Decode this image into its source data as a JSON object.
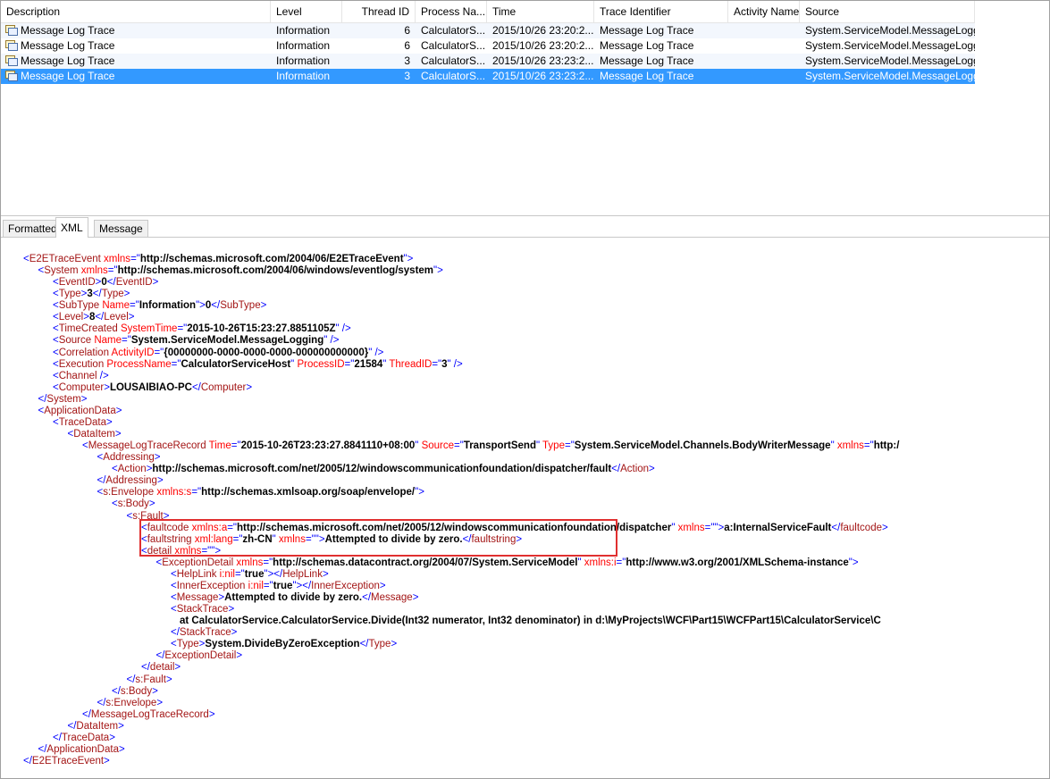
{
  "columns": [
    "Description",
    "Level",
    "Thread ID",
    "Process Na...",
    "Time",
    "Trace Identifier",
    "Activity Name",
    "Source"
  ],
  "rows": [
    {
      "description": "Message Log Trace",
      "level": "Information",
      "thread": "6",
      "process": "CalculatorS...",
      "time": "2015/10/26 23:20:2...",
      "trace": "Message Log Trace",
      "activity": "",
      "source": "System.ServiceModel.MessageLogging"
    },
    {
      "description": "Message Log Trace",
      "level": "Information",
      "thread": "6",
      "process": "CalculatorS...",
      "time": "2015/10/26 23:20:2...",
      "trace": "Message Log Trace",
      "activity": "",
      "source": "System.ServiceModel.MessageLogging"
    },
    {
      "description": "Message Log Trace",
      "level": "Information",
      "thread": "3",
      "process": "CalculatorS...",
      "time": "2015/10/26 23:23:2...",
      "trace": "Message Log Trace",
      "activity": "",
      "source": "System.ServiceModel.MessageLogging"
    },
    {
      "description": "Message Log Trace",
      "level": "Information",
      "thread": "3",
      "process": "CalculatorS...",
      "time": "2015/10/26 23:23:2...",
      "trace": "Message Log Trace",
      "activity": "",
      "source": "System.ServiceModel.MessageLogging"
    }
  ],
  "selected_row": 3,
  "tabs": [
    "Formatted",
    "XML",
    "Message"
  ],
  "active_tab": "XML",
  "xml_lines": [
    {
      "indent": 0,
      "parts": [
        [
          "b",
          "<"
        ],
        [
          "t",
          "E2ETraceEvent "
        ],
        [
          "r",
          "xmlns"
        ],
        [
          "b",
          "=\""
        ],
        [
          "k",
          "http://schemas.microsoft.com/2004/06/E2ETraceEvent"
        ],
        [
          "b",
          "\">"
        ]
      ]
    },
    {
      "indent": 1,
      "parts": [
        [
          "b",
          "<"
        ],
        [
          "t",
          "System "
        ],
        [
          "r",
          "xmlns"
        ],
        [
          "b",
          "=\""
        ],
        [
          "k",
          "http://schemas.microsoft.com/2004/06/windows/eventlog/system"
        ],
        [
          "b",
          "\">"
        ]
      ]
    },
    {
      "indent": 2,
      "parts": [
        [
          "b",
          "<"
        ],
        [
          "t",
          "EventID"
        ],
        [
          "b",
          ">"
        ],
        [
          "k",
          "0"
        ],
        [
          "b",
          "</"
        ],
        [
          "t",
          "EventID"
        ],
        [
          "b",
          ">"
        ]
      ]
    },
    {
      "indent": 2,
      "parts": [
        [
          "b",
          "<"
        ],
        [
          "t",
          "Type"
        ],
        [
          "b",
          ">"
        ],
        [
          "k",
          "3"
        ],
        [
          "b",
          "</"
        ],
        [
          "t",
          "Type"
        ],
        [
          "b",
          ">"
        ]
      ]
    },
    {
      "indent": 2,
      "parts": [
        [
          "b",
          "<"
        ],
        [
          "t",
          "SubType "
        ],
        [
          "r",
          "Name"
        ],
        [
          "b",
          "=\""
        ],
        [
          "k",
          "Information"
        ],
        [
          "b",
          "\">"
        ],
        [
          "k",
          "0"
        ],
        [
          "b",
          "</"
        ],
        [
          "t",
          "SubType"
        ],
        [
          "b",
          ">"
        ]
      ]
    },
    {
      "indent": 2,
      "parts": [
        [
          "b",
          "<"
        ],
        [
          "t",
          "Level"
        ],
        [
          "b",
          ">"
        ],
        [
          "k",
          "8"
        ],
        [
          "b",
          "</"
        ],
        [
          "t",
          "Level"
        ],
        [
          "b",
          ">"
        ]
      ]
    },
    {
      "indent": 2,
      "parts": [
        [
          "b",
          "<"
        ],
        [
          "t",
          "TimeCreated "
        ],
        [
          "r",
          "SystemTime"
        ],
        [
          "b",
          "=\""
        ],
        [
          "k",
          "2015-10-26T15:23:27.8851105Z"
        ],
        [
          "b",
          "\" />"
        ]
      ]
    },
    {
      "indent": 2,
      "parts": [
        [
          "b",
          "<"
        ],
        [
          "t",
          "Source "
        ],
        [
          "r",
          "Name"
        ],
        [
          "b",
          "=\""
        ],
        [
          "k",
          "System.ServiceModel.MessageLogging"
        ],
        [
          "b",
          "\" />"
        ]
      ]
    },
    {
      "indent": 2,
      "parts": [
        [
          "b",
          "<"
        ],
        [
          "t",
          "Correlation "
        ],
        [
          "r",
          "ActivityID"
        ],
        [
          "b",
          "=\""
        ],
        [
          "k",
          "{00000000-0000-0000-0000-000000000000}"
        ],
        [
          "b",
          "\" />"
        ]
      ]
    },
    {
      "indent": 2,
      "parts": [
        [
          "b",
          "<"
        ],
        [
          "t",
          "Execution "
        ],
        [
          "r",
          "ProcessName"
        ],
        [
          "b",
          "=\""
        ],
        [
          "k",
          "CalculatorServiceHost"
        ],
        [
          "b",
          "\" "
        ],
        [
          "r",
          "ProcessID"
        ],
        [
          "b",
          "=\""
        ],
        [
          "k",
          "21584"
        ],
        [
          "b",
          "\" "
        ],
        [
          "r",
          "ThreadID"
        ],
        [
          "b",
          "=\""
        ],
        [
          "k",
          "3"
        ],
        [
          "b",
          "\" />"
        ]
      ]
    },
    {
      "indent": 2,
      "parts": [
        [
          "b",
          "<"
        ],
        [
          "t",
          "Channel "
        ],
        [
          "b",
          "/>"
        ]
      ]
    },
    {
      "indent": 2,
      "parts": [
        [
          "b",
          "<"
        ],
        [
          "t",
          "Computer"
        ],
        [
          "b",
          ">"
        ],
        [
          "k",
          "LOUSAIBIAO-PC"
        ],
        [
          "b",
          "</"
        ],
        [
          "t",
          "Computer"
        ],
        [
          "b",
          ">"
        ]
      ]
    },
    {
      "indent": 1,
      "parts": [
        [
          "b",
          "</"
        ],
        [
          "t",
          "System"
        ],
        [
          "b",
          ">"
        ]
      ]
    },
    {
      "indent": 1,
      "parts": [
        [
          "b",
          "<"
        ],
        [
          "t",
          "ApplicationData"
        ],
        [
          "b",
          ">"
        ]
      ]
    },
    {
      "indent": 2,
      "parts": [
        [
          "b",
          "<"
        ],
        [
          "t",
          "TraceData"
        ],
        [
          "b",
          ">"
        ]
      ]
    },
    {
      "indent": 3,
      "parts": [
        [
          "b",
          "<"
        ],
        [
          "t",
          "DataItem"
        ],
        [
          "b",
          ">"
        ]
      ]
    },
    {
      "indent": 4,
      "parts": [
        [
          "b",
          "<"
        ],
        [
          "t",
          "MessageLogTraceRecord "
        ],
        [
          "r",
          "Time"
        ],
        [
          "b",
          "=\""
        ],
        [
          "k",
          "2015-10-26T23:23:27.8841110+08:00"
        ],
        [
          "b",
          "\" "
        ],
        [
          "r",
          "Source"
        ],
        [
          "b",
          "=\""
        ],
        [
          "k",
          "TransportSend"
        ],
        [
          "b",
          "\" "
        ],
        [
          "r",
          "Type"
        ],
        [
          "b",
          "=\""
        ],
        [
          "k",
          "System.ServiceModel.Channels.BodyWriterMessage"
        ],
        [
          "b",
          "\" "
        ],
        [
          "r",
          "xmlns"
        ],
        [
          "b",
          "=\""
        ],
        [
          "k",
          "http:/"
        ]
      ]
    },
    {
      "indent": 5,
      "parts": [
        [
          "b",
          "<"
        ],
        [
          "t",
          "Addressing"
        ],
        [
          "b",
          ">"
        ]
      ]
    },
    {
      "indent": 6,
      "parts": [
        [
          "b",
          "<"
        ],
        [
          "t",
          "Action"
        ],
        [
          "b",
          ">"
        ],
        [
          "k",
          "http://schemas.microsoft.com/net/2005/12/windowscommunicationfoundation/dispatcher/fault"
        ],
        [
          "b",
          "</"
        ],
        [
          "t",
          "Action"
        ],
        [
          "b",
          ">"
        ]
      ]
    },
    {
      "indent": 5,
      "parts": [
        [
          "b",
          "</"
        ],
        [
          "t",
          "Addressing"
        ],
        [
          "b",
          ">"
        ]
      ]
    },
    {
      "indent": 5,
      "parts": [
        [
          "b",
          "<"
        ],
        [
          "t",
          "s:Envelope "
        ],
        [
          "r",
          "xmlns:s"
        ],
        [
          "b",
          "=\""
        ],
        [
          "k",
          "http://schemas.xmlsoap.org/soap/envelope/"
        ],
        [
          "b",
          "\">"
        ]
      ]
    },
    {
      "indent": 6,
      "parts": [
        [
          "b",
          "<"
        ],
        [
          "t",
          "s:Body"
        ],
        [
          "b",
          ">"
        ]
      ]
    },
    {
      "indent": 7,
      "parts": [
        [
          "b",
          "<"
        ],
        [
          "t",
          "s:Fault"
        ],
        [
          "b",
          ">"
        ]
      ]
    },
    {
      "indent": 8,
      "parts": [
        [
          "b",
          "<"
        ],
        [
          "t",
          "faultcode "
        ],
        [
          "r",
          "xmlns:a"
        ],
        [
          "b",
          "=\""
        ],
        [
          "k",
          "http://schemas.microsoft.com/net/2005/12/windowscommunicationfoundation/dispatcher"
        ],
        [
          "b",
          "\" "
        ],
        [
          "r",
          "xmlns"
        ],
        [
          "b",
          "=\"\">"
        ],
        [
          "k",
          "a:InternalServiceFault"
        ],
        [
          "b",
          "</"
        ],
        [
          "t",
          "faultcode"
        ],
        [
          "b",
          ">"
        ]
      ]
    },
    {
      "indent": 8,
      "parts": [
        [
          "b",
          "<"
        ],
        [
          "t",
          "faultstring "
        ],
        [
          "r",
          "xml:lang"
        ],
        [
          "b",
          "=\""
        ],
        [
          "k",
          "zh-CN"
        ],
        [
          "b",
          "\" "
        ],
        [
          "r",
          "xmlns"
        ],
        [
          "b",
          "=\"\">"
        ],
        [
          "k",
          "Attempted to divide by zero."
        ],
        [
          "b",
          "</"
        ],
        [
          "t",
          "faultstring"
        ],
        [
          "b",
          ">"
        ]
      ]
    },
    {
      "indent": 8,
      "parts": [
        [
          "b",
          "<"
        ],
        [
          "t",
          "detail "
        ],
        [
          "r",
          "xmlns"
        ],
        [
          "b",
          "=\"\">"
        ]
      ]
    },
    {
      "indent": 9,
      "parts": [
        [
          "b",
          "<"
        ],
        [
          "t",
          "ExceptionDetail "
        ],
        [
          "r",
          "xmlns"
        ],
        [
          "b",
          "=\""
        ],
        [
          "k",
          "http://schemas.datacontract.org/2004/07/System.ServiceModel"
        ],
        [
          "b",
          "\" "
        ],
        [
          "r",
          "xmlns:i"
        ],
        [
          "b",
          "=\""
        ],
        [
          "k",
          "http://www.w3.org/2001/XMLSchema-instance"
        ],
        [
          "b",
          "\">"
        ]
      ]
    },
    {
      "indent": 10,
      "parts": [
        [
          "b",
          "<"
        ],
        [
          "t",
          "HelpLink "
        ],
        [
          "r",
          "i:nil"
        ],
        [
          "b",
          "=\""
        ],
        [
          "k",
          "true"
        ],
        [
          "b",
          "\"></"
        ],
        [
          "t",
          "HelpLink"
        ],
        [
          "b",
          ">"
        ]
      ]
    },
    {
      "indent": 10,
      "parts": [
        [
          "b",
          "<"
        ],
        [
          "t",
          "InnerException "
        ],
        [
          "r",
          "i:nil"
        ],
        [
          "b",
          "=\""
        ],
        [
          "k",
          "true"
        ],
        [
          "b",
          "\"></"
        ],
        [
          "t",
          "InnerException"
        ],
        [
          "b",
          ">"
        ]
      ]
    },
    {
      "indent": 10,
      "parts": [
        [
          "b",
          "<"
        ],
        [
          "t",
          "Message"
        ],
        [
          "b",
          ">"
        ],
        [
          "k",
          "Attempted to divide by zero."
        ],
        [
          "b",
          "</"
        ],
        [
          "t",
          "Message"
        ],
        [
          "b",
          ">"
        ]
      ]
    },
    {
      "indent": 10,
      "parts": [
        [
          "b",
          "<"
        ],
        [
          "t",
          "StackTrace"
        ],
        [
          "b",
          ">"
        ]
      ]
    },
    {
      "indent": 10,
      "extra": true,
      "parts": [
        [
          "k",
          "at CalculatorService.CalculatorService.Divide(Int32 numerator, Int32 denominator) in d:\\MyProjects\\WCF\\Part15\\WCFPart15\\CalculatorService\\C"
        ]
      ]
    },
    {
      "indent": 10,
      "parts": [
        [
          "b",
          "</"
        ],
        [
          "t",
          "StackTrace"
        ],
        [
          "b",
          ">"
        ]
      ]
    },
    {
      "indent": 10,
      "parts": [
        [
          "b",
          "<"
        ],
        [
          "t",
          "Type"
        ],
        [
          "b",
          ">"
        ],
        [
          "k",
          "System.DivideByZeroException"
        ],
        [
          "b",
          "</"
        ],
        [
          "t",
          "Type"
        ],
        [
          "b",
          ">"
        ]
      ]
    },
    {
      "indent": 9,
      "parts": [
        [
          "b",
          "</"
        ],
        [
          "t",
          "ExceptionDetail"
        ],
        [
          "b",
          ">"
        ]
      ]
    },
    {
      "indent": 8,
      "parts": [
        [
          "b",
          "</"
        ],
        [
          "t",
          "detail"
        ],
        [
          "b",
          ">"
        ]
      ]
    },
    {
      "indent": 7,
      "parts": [
        [
          "b",
          "</"
        ],
        [
          "t",
          "s:Fault"
        ],
        [
          "b",
          ">"
        ]
      ]
    },
    {
      "indent": 6,
      "parts": [
        [
          "b",
          "</"
        ],
        [
          "t",
          "s:Body"
        ],
        [
          "b",
          ">"
        ]
      ]
    },
    {
      "indent": 5,
      "parts": [
        [
          "b",
          "</"
        ],
        [
          "t",
          "s:Envelope"
        ],
        [
          "b",
          ">"
        ]
      ]
    },
    {
      "indent": 4,
      "parts": [
        [
          "b",
          "</"
        ],
        [
          "t",
          "MessageLogTraceRecord"
        ],
        [
          "b",
          ">"
        ]
      ]
    },
    {
      "indent": 3,
      "parts": [
        [
          "b",
          "</"
        ],
        [
          "t",
          "DataItem"
        ],
        [
          "b",
          ">"
        ]
      ]
    },
    {
      "indent": 2,
      "parts": [
        [
          "b",
          "</"
        ],
        [
          "t",
          "TraceData"
        ],
        [
          "b",
          ">"
        ]
      ]
    },
    {
      "indent": 1,
      "parts": [
        [
          "b",
          "</"
        ],
        [
          "t",
          "ApplicationData"
        ],
        [
          "b",
          ">"
        ]
      ]
    },
    {
      "indent": 0,
      "parts": [
        [
          "b",
          "</"
        ],
        [
          "t",
          "E2ETraceEvent"
        ],
        [
          "b",
          ">"
        ]
      ]
    }
  ],
  "colors": {
    "selection": "#3399ff",
    "tag": "#a31515",
    "punct": "#0000ff",
    "attr": "#ff0000",
    "highlight_box": "#e03030"
  }
}
